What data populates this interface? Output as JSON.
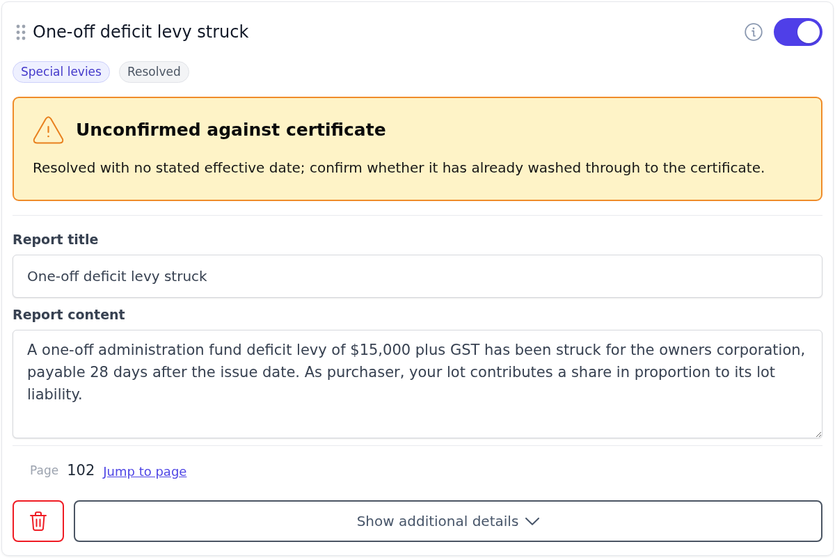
{
  "card": {
    "title": "One-off deficit levy struck",
    "enabled": true,
    "tags": [
      {
        "label": "Special levies",
        "kind": "category"
      },
      {
        "label": "Resolved",
        "kind": "status"
      }
    ],
    "alert": {
      "kind": "warning",
      "title": "Unconfirmed against certificate",
      "message": "Resolved with no stated effective date; confirm whether it has already washed through to the certificate."
    },
    "fields": [
      {
        "label": "Report title",
        "kind": "input",
        "value": "One-off deficit levy struck"
      },
      {
        "label": "Report content",
        "kind": "textarea",
        "value": "A one-off administration fund deficit levy of $15,000 plus GST has been struck for the owners corporation, payable 28 days after the issue date. As purchaser, your lot contributes a share in proportion to its lot liability."
      }
    ],
    "page": {
      "label": "Page",
      "number": "102",
      "link": "Jump to page"
    },
    "actions": {
      "expand_label": "Show additional details",
      "expanded": false
    }
  }
}
